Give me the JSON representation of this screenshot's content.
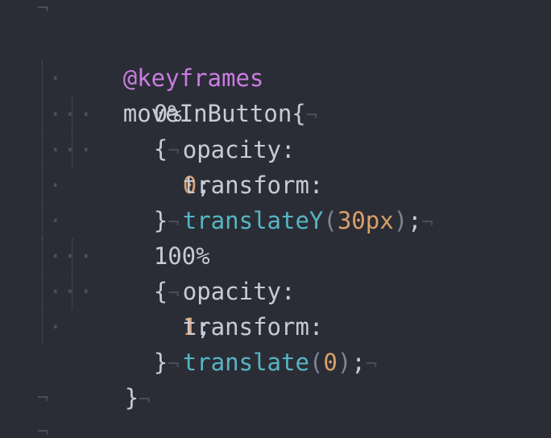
{
  "editor": {
    "eol_marker": "¬",
    "indent_marker": "·",
    "lines": [
      {
        "text": ""
      },
      {
        "at_rule": "@keyframes",
        "name": "moveInButton",
        "brace": "{"
      },
      {
        "selector": "0%",
        "brace": "{"
      },
      {
        "property": "opacity",
        "colon": ":",
        "value": "0",
        "semi": ";"
      },
      {
        "property": "transform",
        "colon": ":",
        "func": "translateY",
        "open": "(",
        "arg": "30px",
        "close": ")",
        "semi": ";"
      },
      {
        "brace": "}"
      },
      {
        "selector": "100%",
        "brace": "{"
      },
      {
        "property": "opacity",
        "colon": ":",
        "value": "1",
        "semi": ";"
      },
      {
        "property": "transform",
        "colon": ":",
        "func": "translate",
        "open": "(",
        "arg": "0",
        "close": ")",
        "semi": ";"
      },
      {
        "brace": "}"
      },
      {
        "brace": "}"
      },
      {
        "text": ""
      },
      {
        "text": ""
      }
    ]
  }
}
